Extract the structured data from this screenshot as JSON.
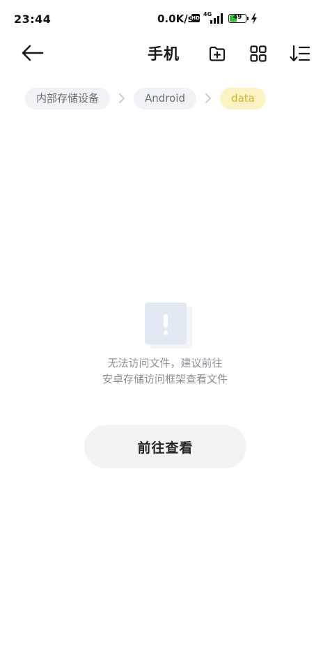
{
  "status_bar": {
    "time": "23:44",
    "net_speed": "0.0K/s",
    "hd": "HD",
    "network": "4G",
    "battery_level": "49",
    "battery_fraction": 0.49
  },
  "header": {
    "title": "手机",
    "icons": [
      "back-arrow-icon",
      "new-folder-icon",
      "grid-view-icon",
      "sort-icon"
    ]
  },
  "breadcrumb": {
    "items": [
      {
        "label": "内部存储设备"
      },
      {
        "label": "Android"
      },
      {
        "label": "data"
      }
    ]
  },
  "empty_state": {
    "message_line1": "无法访问文件，建议前往",
    "message_line2": "安卓存储访问框架查看文件",
    "button_label": "前往查看"
  },
  "colors": {
    "accent_active_crumb_bg": "#fdf2c4",
    "accent_active_crumb_text": "#d9b32a",
    "battery_green": "#26c52b"
  }
}
